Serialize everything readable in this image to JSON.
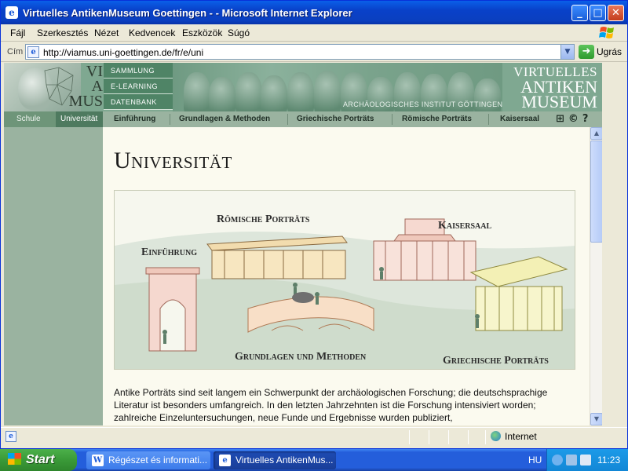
{
  "window": {
    "title": "Virtuelles AntikenMuseum Goettingen - - Microsoft Internet Explorer",
    "minimize": "_",
    "maximize": "□",
    "close": "✕"
  },
  "menu": [
    "Fájl",
    "Szerkesztés",
    "Nézet",
    "Kedvencek",
    "Eszközök",
    "Súgó"
  ],
  "address": {
    "label": "Cím",
    "url": "http://viamus.uni-goettingen.de/fr/e/uni",
    "go_label": "Ugrás"
  },
  "site": {
    "logo_letters": [
      "VI",
      "A",
      "MUS"
    ],
    "subnav": [
      "SAMMLUNG",
      "E-LEARNING",
      "DATENBANK"
    ],
    "institute": "ARCHÄOLOGISCHES INSTITUT GÖTTINGEN",
    "brand": [
      "VIRTUELLES",
      "ANTIKEN",
      "MUSEUM"
    ],
    "nav_left": [
      "Schule",
      "Universität"
    ],
    "nav": [
      "Einführung",
      "Grundlagen & Methoden",
      "Griechische Porträts",
      "Römische Porträts",
      "Kaisersaal"
    ],
    "nav_icons": [
      "sitemap-icon",
      "copyright-icon",
      "help-icon"
    ]
  },
  "content": {
    "heading": "Universität",
    "illustration_labels": {
      "roemische": "Römische Porträts",
      "kaisersaal": "Kaisersaal",
      "einfuehrung": "Einführung",
      "grundlagen": "Grundlagen und Methoden",
      "griechische": "Griechische Porträts"
    },
    "paragraph": "Antike Porträts sind seit langem ein Schwerpunkt der archäologischen Forschung; die deutschsprachige Literatur ist besonders umfangreich. In den letzten Jahrzehnten ist die Forschung intensiviert worden; zahlreiche Einzeluntersuchungen, neue Funde und Ergebnisse wurden publiziert,"
  },
  "status": {
    "zone": "Internet"
  },
  "taskbar": {
    "start": "Start",
    "tasks": [
      "Régészet és informati...",
      "Virtuelles AntikenMus..."
    ],
    "lang": "HU",
    "clock": "11:23"
  }
}
